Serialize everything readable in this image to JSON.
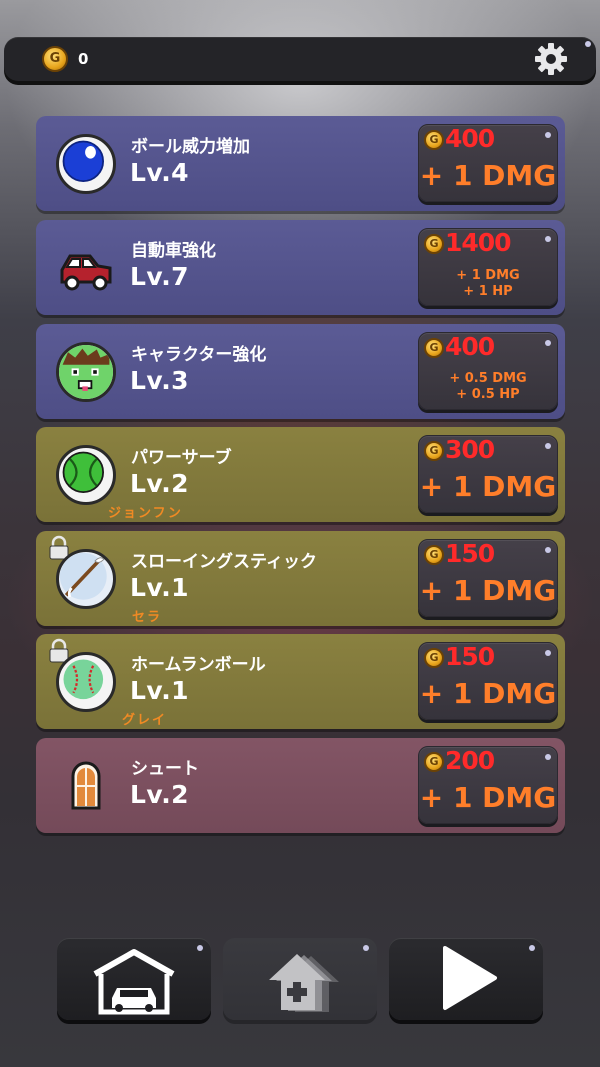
{
  "header": {
    "coin_icon": "gold-coin-icon",
    "coin_letter": "G",
    "coin_count": "0",
    "settings_icon": "gear-icon"
  },
  "upgrades": [
    {
      "name": "ボール威力増加",
      "level": "Lv.4",
      "owner": "",
      "price": "400",
      "effect": "+ 1 DMG",
      "effect_lines": [],
      "locked": false,
      "icon": "blue-ball-icon",
      "color": "#5b5b95"
    },
    {
      "name": "自動車強化",
      "level": "Lv.7",
      "owner": "",
      "price": "1400",
      "effect": "",
      "effect_lines": [
        "+ 1 DMG",
        "+ 1 HP"
      ],
      "locked": false,
      "icon": "red-car-icon",
      "color": "#5b5b95"
    },
    {
      "name": "キャラクター強化",
      "level": "Lv.3",
      "owner": "",
      "price": "400",
      "effect": "",
      "effect_lines": [
        "+ 0.5 DMG",
        "+ 0.5 HP"
      ],
      "locked": false,
      "icon": "character-face-icon",
      "color": "#5b5b95"
    },
    {
      "name": "パワーサーブ",
      "level": "Lv.2",
      "owner": "ジョンフン",
      "price": "300",
      "effect": "+ 1 DMG",
      "effect_lines": [],
      "locked": false,
      "icon": "tennis-ball-icon",
      "color": "#8a8140"
    },
    {
      "name": "スローイングスティック",
      "level": "Lv.1",
      "owner": "セラ",
      "price": "150",
      "effect": "+ 1 DMG",
      "effect_lines": [],
      "locked": true,
      "icon": "throwing-stick-icon",
      "color": "#8a8140"
    },
    {
      "name": "ホームランボール",
      "level": "Lv.1",
      "owner": "グレイ",
      "price": "150",
      "effect": "+ 1 DMG",
      "effect_lines": [],
      "locked": true,
      "icon": "baseball-icon",
      "color": "#8a8140"
    },
    {
      "name": "シュート",
      "level": "Lv.2",
      "owner": "",
      "price": "200",
      "effect": "+ 1 DMG",
      "effect_lines": [],
      "locked": false,
      "icon": "shoot-door-icon",
      "color": "#835565"
    }
  ],
  "bottom_nav": {
    "garage_icon": "garage-icon",
    "upgrade_icon": "upgrade-stack-icon",
    "play_icon": "play-icon"
  }
}
